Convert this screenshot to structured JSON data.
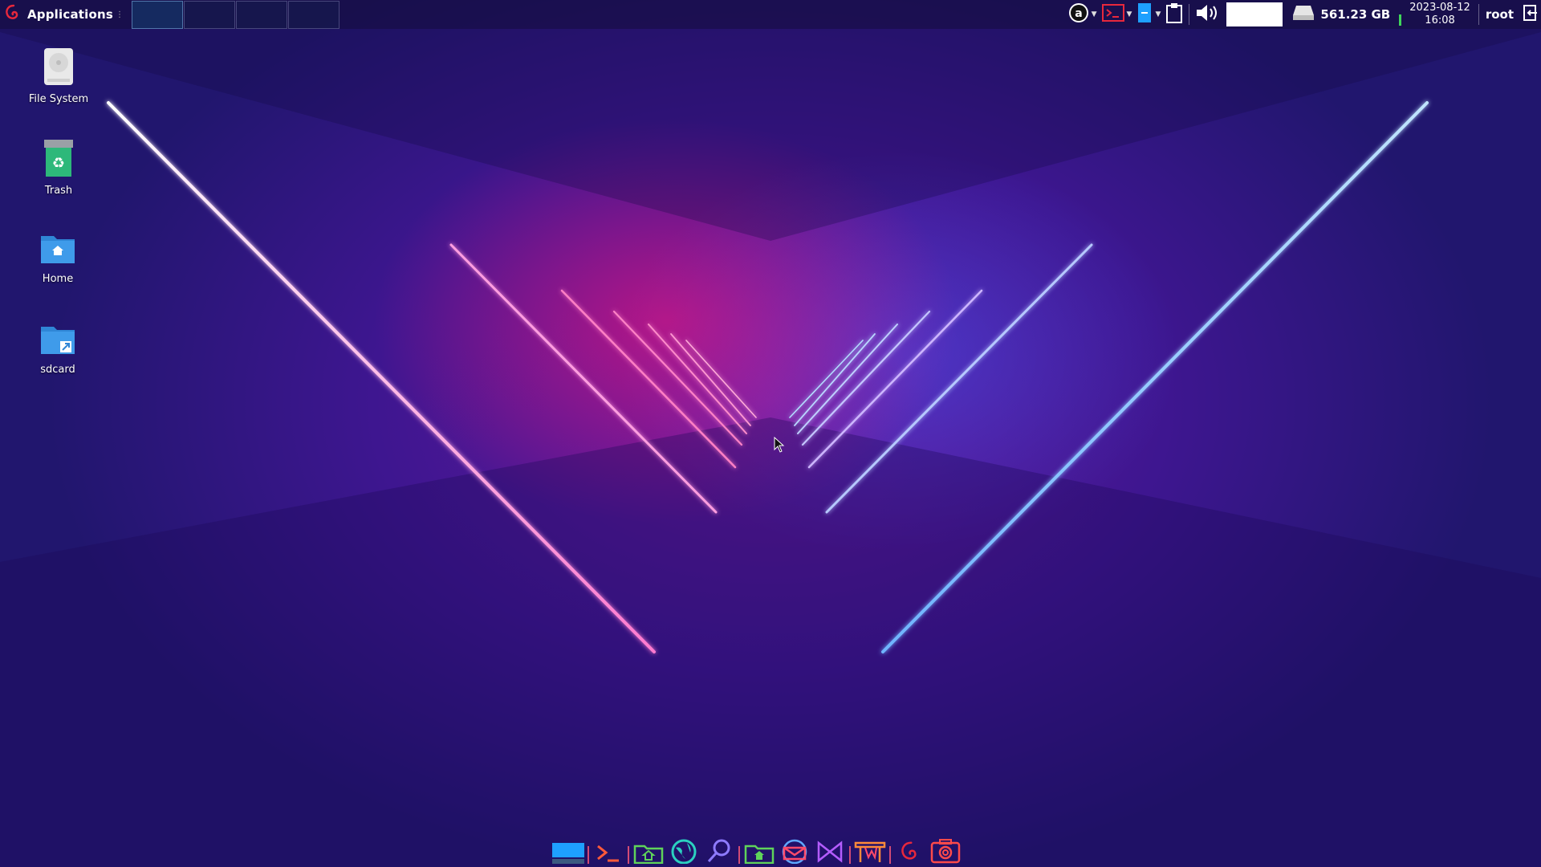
{
  "panel": {
    "applications_label": "Applications",
    "workspaces": [
      {
        "id": "ws1",
        "active": true
      },
      {
        "id": "ws2",
        "active": false
      },
      {
        "id": "ws3",
        "active": false
      },
      {
        "id": "ws4",
        "active": false
      }
    ],
    "disk_free": "561.23 GB",
    "date": "2023-08-12",
    "time": "16:08",
    "user": "root"
  },
  "desktop": {
    "icons": [
      {
        "label": "File System",
        "icon": "harddrive-icon"
      },
      {
        "label": "Trash",
        "icon": "trash-icon"
      },
      {
        "label": "Home",
        "icon": "home-folder-icon"
      },
      {
        "label": "sdcard",
        "icon": "symlink-folder-icon"
      }
    ]
  },
  "dock": {
    "items": [
      {
        "icon": "show-desktop-icon"
      },
      {
        "icon": "terminal-icon"
      },
      {
        "icon": "file-manager-icon"
      },
      {
        "icon": "web-browser-icon"
      },
      {
        "icon": "app-finder-icon"
      },
      {
        "icon": "home-folder-icon"
      },
      {
        "icon": "mail-icon"
      },
      {
        "icon": "code-editor-icon"
      },
      {
        "icon": "app-store-icon"
      },
      {
        "icon": "debian-icon"
      },
      {
        "icon": "screenshot-icon"
      }
    ]
  },
  "colors": {
    "accent_red": "#e8283c",
    "accent_blue": "#1ea0ff",
    "neon_pink": "#ff3d8b",
    "neon_blue": "#3a7bff"
  }
}
